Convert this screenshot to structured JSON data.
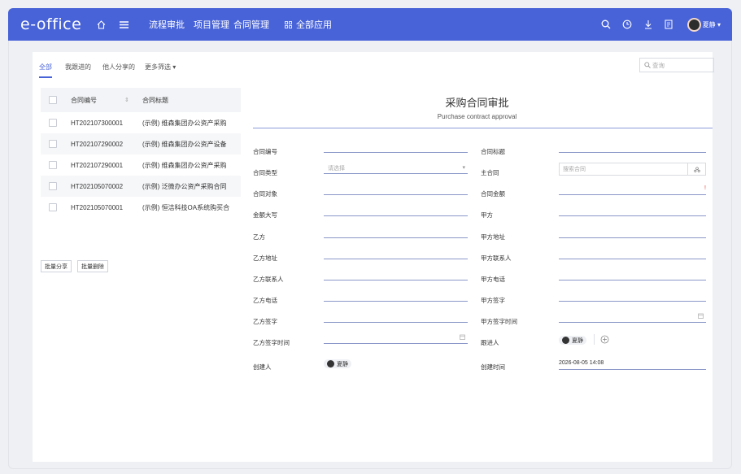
{
  "app": {
    "logo": "e-office",
    "nav": [
      "流程审批",
      "项目管理",
      "合同管理",
      "全部应用"
    ],
    "user": "夏静"
  },
  "filters": {
    "tabs": [
      "全部",
      "我跟进的",
      "他人分享的",
      "更多筛选 ▾"
    ],
    "search_placeholder": "查询"
  },
  "list": {
    "header": {
      "no": "合同编号",
      "sort": "⇕",
      "title": "合同标题"
    },
    "rows": [
      {
        "no": "HT202107300001",
        "title": "(示例) 维森集团办公资产采购"
      },
      {
        "no": "HT202107290002",
        "title": "(示例) 维森集团办公资产设备"
      },
      {
        "no": "HT202107290001",
        "title": "(示例) 维森集团办公资产采购"
      },
      {
        "no": "HT202105070002",
        "title": "(示例) 泛微办公资产采购合同"
      },
      {
        "no": "HT202105070001",
        "title": "(示例) 恒洁科技OA系统购买合"
      }
    ],
    "batch_share": "批量分享",
    "batch_delete": "批量删除"
  },
  "form": {
    "title_cn": "采购合同审批",
    "title_en": "Purchase contract approval",
    "left": {
      "no": "合同编号",
      "type": "合同类型",
      "type_placeholder": "请选择",
      "object": "合同对象",
      "amount_words": "金额大写",
      "party_b": "乙方",
      "b_address": "乙方地址",
      "b_contact": "乙方联系人",
      "b_phone": "乙方电话",
      "b_sign": "乙方签字",
      "b_sign_time": "乙方签字时间",
      "creator": "创建人",
      "creator_value": "夏静"
    },
    "right": {
      "title": "合同标题",
      "main": "主合同",
      "main_placeholder": "搜索合同",
      "amount": "合同金额",
      "amount_required": "!",
      "party_a": "甲方",
      "a_address": "甲方地址",
      "a_contact": "甲方联系人",
      "a_phone": "甲方电话",
      "a_sign": "甲方签字",
      "a_sign_time": "甲方签字时间",
      "follower": "跟进人",
      "follower_value": "夏静",
      "created_time": "创建时间",
      "created_time_value": "2026-08-05 14:08"
    }
  }
}
